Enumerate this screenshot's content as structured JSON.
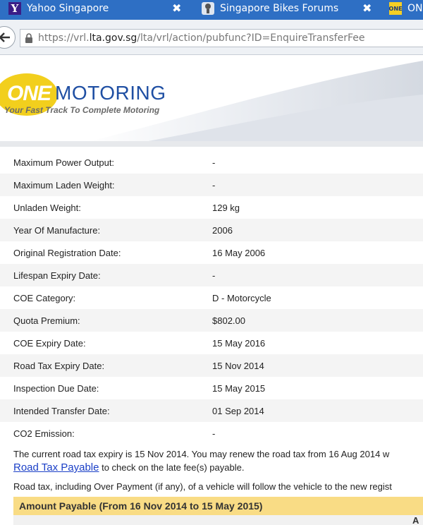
{
  "tabs": [
    {
      "title": "Yahoo Singapore",
      "icon": "yahoo-icon",
      "favicon_text": "Y"
    },
    {
      "title": "Singapore Bikes Forums",
      "icon": "bikes-forum-icon"
    },
    {
      "title": "ON",
      "icon": "onemotoring-icon",
      "favicon_text": "ONE"
    }
  ],
  "tab_close_glyph": "✖",
  "address_bar": {
    "prefix": "https://vrl.",
    "domain": "lta.gov.sg",
    "path": "/lta/vrl/action/pubfunc?ID=EnquireTransferFee"
  },
  "banner": {
    "logo_one": "ONE",
    "logo_motoring": "MOTORING",
    "tagline": "Your Fast Track To Complete Motoring"
  },
  "details": [
    {
      "label": "Maximum Power Output:",
      "value": "-"
    },
    {
      "label": "Maximum Laden Weight:",
      "value": "-"
    },
    {
      "label": "Unladen Weight:",
      "value": "129 kg"
    },
    {
      "label": "Year Of Manufacture:",
      "value": "2006"
    },
    {
      "label": "Original Registration Date:",
      "value": "16 May 2006"
    },
    {
      "label": "Lifespan Expiry Date:",
      "value": "-"
    },
    {
      "label": "COE Category:",
      "value": "D - Motorcycle"
    },
    {
      "label": "Quota Premium:",
      "value": "$802.00"
    },
    {
      "label": "COE Expiry Date:",
      "value": "15 May 2016"
    },
    {
      "label": "Road Tax Expiry Date:",
      "value": "15 Nov 2014"
    },
    {
      "label": "Inspection Due Date:",
      "value": "15 May 2015"
    },
    {
      "label": "Intended Transfer Date:",
      "value": "01 Sep 2014"
    },
    {
      "label": "CO2 Emission:",
      "value": "-"
    }
  ],
  "notes": {
    "road_tax_line": "The current road tax expiry is 15 Nov 2014. You may renew the road tax from 16 Aug 2014 w",
    "road_tax_link": "Road Tax Payable",
    "road_tax_link_suffix": " to check on the late fee(s) payable.",
    "overpayment_line": "Road tax, including Over Payment (if any), of a vehicle will follow the vehicle to the new regist"
  },
  "amount_payable": {
    "heading": "Amount Payable (From 16 Nov 2014 to 15 May 2015)",
    "column_head_partial": "A"
  }
}
